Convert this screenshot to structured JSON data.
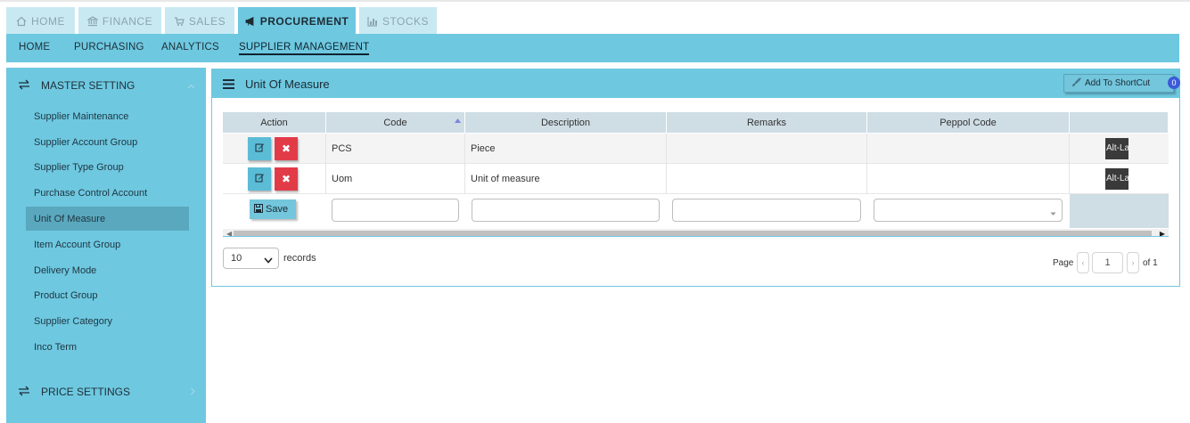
{
  "module_tabs": [
    {
      "label": "HOME",
      "icon": "home-icon"
    },
    {
      "label": "FINANCE",
      "icon": "bank-icon"
    },
    {
      "label": "SALES",
      "icon": "cart-icon"
    },
    {
      "label": "PROCUREMENT",
      "icon": "megaphone-icon",
      "active": true
    },
    {
      "label": "STOCKS",
      "icon": "bar-chart-icon"
    }
  ],
  "sub_nav": [
    {
      "label": "HOME"
    },
    {
      "label": "PURCHASING"
    },
    {
      "label": "ANALYTICS"
    },
    {
      "label": "SUPPLIER MANAGEMENT",
      "active": true
    }
  ],
  "sidebar": {
    "master_setting": "MASTER SETTING",
    "items": [
      {
        "label": "Supplier Maintenance"
      },
      {
        "label": "Supplier Account Group"
      },
      {
        "label": "Supplier Type Group"
      },
      {
        "label": "Purchase Control Account"
      },
      {
        "label": "Unit Of Measure",
        "active": true
      },
      {
        "label": "Item Account Group"
      },
      {
        "label": "Delivery Mode"
      },
      {
        "label": "Product Group"
      },
      {
        "label": "Supplier Category"
      },
      {
        "label": "Inco Term"
      }
    ],
    "price_settings": "PRICE SETTINGS"
  },
  "panel": {
    "title": "Unit Of Measure",
    "shortcut_label": "Add To ShortCut",
    "shortcut_count": "0"
  },
  "table": {
    "columns": [
      "Action",
      "Code",
      "Description",
      "Remarks",
      "Peppol Code"
    ],
    "rows": [
      {
        "code": "PCS",
        "description": "Piece",
        "remarks": "",
        "peppol": "",
        "extra": "Alt-Lab"
      },
      {
        "code": "Uom",
        "description": "Unit of measure",
        "remarks": "",
        "peppol": "",
        "extra": "Alt-Lab"
      }
    ],
    "save_label": "Save"
  },
  "footer": {
    "page_size": "10",
    "records_label": "records",
    "page_label": "Page",
    "current_page": "1",
    "of_label": "of 1"
  },
  "colors": {
    "accent": "#6ec8e0",
    "active_sidebar": "#5aa8bd",
    "delete": "#e23b48",
    "badge": "#3b5bd9"
  }
}
